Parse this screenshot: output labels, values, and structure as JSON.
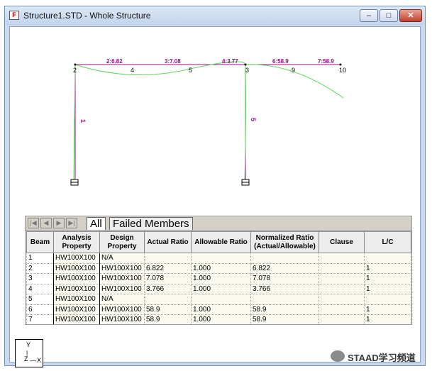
{
  "window": {
    "title": "Structure1.STD - Whole Structure",
    "app_icon": "staad-app-icon",
    "controls": {
      "minimize": "–",
      "maximize": "□",
      "close": "✕"
    }
  },
  "model": {
    "node_labels": [
      "2",
      "4",
      "5",
      "3",
      "9",
      "10"
    ],
    "member_labels": [
      "1",
      "5"
    ],
    "beam_result_labels": [
      "2:6.82",
      "3:7.08",
      "4:3.77",
      "6:58.9",
      "7:58.9"
    ],
    "colors": {
      "ratio_text": "#9b0c8a",
      "deflection_line": "#5fd55a",
      "member_line": "#9b0c8a"
    }
  },
  "table": {
    "nav_buttons": [
      "|◀",
      "◀",
      "▶",
      "▶|"
    ],
    "tabs": [
      "All",
      "Failed Members"
    ],
    "columns": [
      "Beam",
      "Analysis Property",
      "Design Property",
      "Actual Ratio",
      "Allowable Ratio",
      "Normalized Ratio (Actual/Allowable)",
      "Clause",
      "L/C"
    ],
    "rows": [
      [
        "1",
        "HW100X100",
        "N/A",
        "",
        "",
        "",
        "",
        ""
      ],
      [
        "2",
        "HW100X100",
        "HW100X100",
        "6.822",
        "1.000",
        "6.822",
        "",
        "1"
      ],
      [
        "3",
        "HW100X100",
        "HW100X100",
        "7.078",
        "1.000",
        "7.078",
        "",
        "1"
      ],
      [
        "4",
        "HW100X100",
        "HW100X100",
        "3.766",
        "1.000",
        "3.766",
        "",
        "1"
      ],
      [
        "5",
        "HW100X100",
        "N/A",
        "",
        "",
        "",
        "",
        ""
      ],
      [
        "6",
        "HW100X100",
        "HW100X100",
        "58.9",
        "1.000",
        "58.9",
        "",
        "1"
      ],
      [
        "7",
        "HW100X100",
        "HW100X100",
        "58.9",
        "1.000",
        "58.9",
        "",
        "1"
      ]
    ]
  },
  "axis": {
    "y": "Y",
    "x": "X",
    "z": "Z"
  },
  "watermark": {
    "text": "STAAD学习频道",
    "icon": "wechat-icon"
  }
}
